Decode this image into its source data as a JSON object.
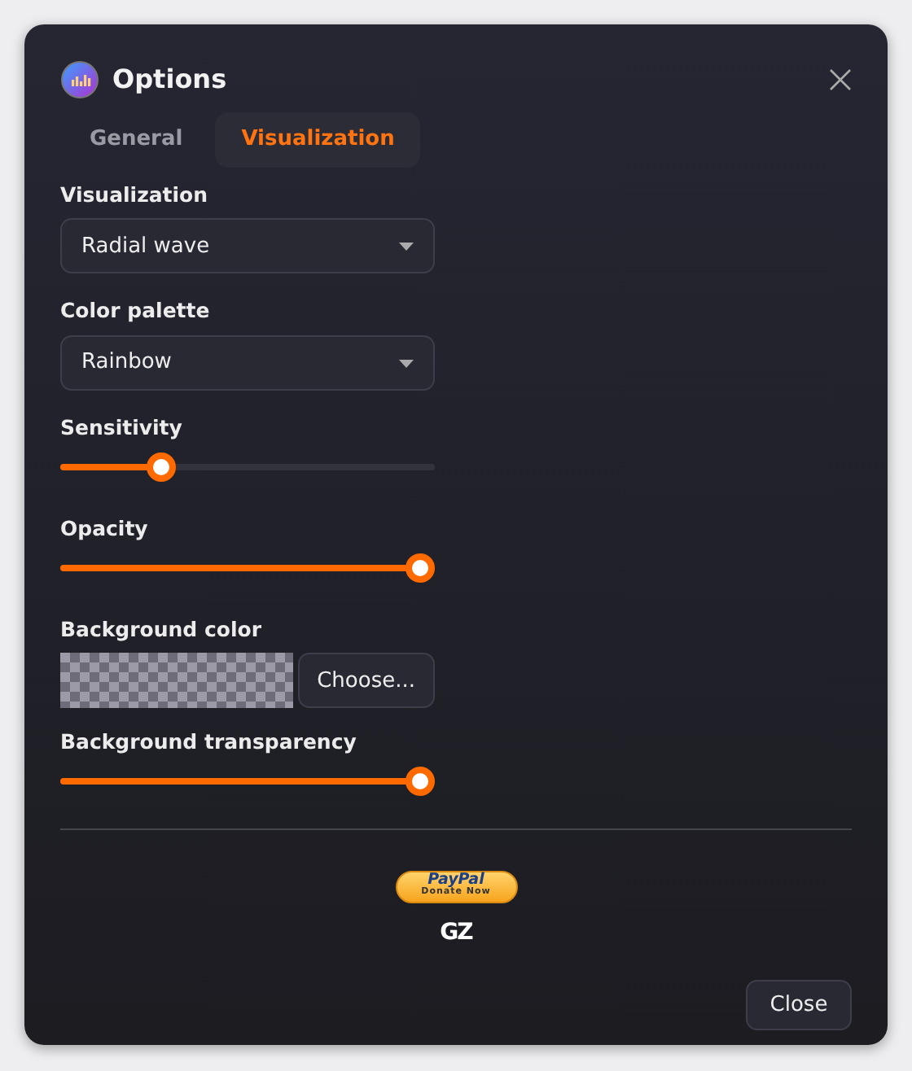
{
  "window": {
    "title": "Options"
  },
  "tabs": [
    {
      "label": "General",
      "selected": false
    },
    {
      "label": "Visualization",
      "selected": true
    }
  ],
  "fields": [
    {
      "kind": "select",
      "label": "Visualization",
      "value": "Radial wave"
    },
    {
      "kind": "select",
      "label": "Color palette",
      "value": "Rainbow"
    },
    {
      "kind": "slider",
      "label": "Sensitivity",
      "level": 0.25
    },
    {
      "kind": "slider",
      "label": "Opacity",
      "level": 1
    },
    {
      "kind": "color",
      "label": "Background color",
      "button": "Choose..."
    },
    {
      "kind": "slider",
      "label": "Background transparency",
      "level": 1
    }
  ],
  "donate": {
    "brand": "PayPal",
    "caption": "Donate Now"
  },
  "logo": "GZ",
  "buttons": [
    "Close"
  ]
}
